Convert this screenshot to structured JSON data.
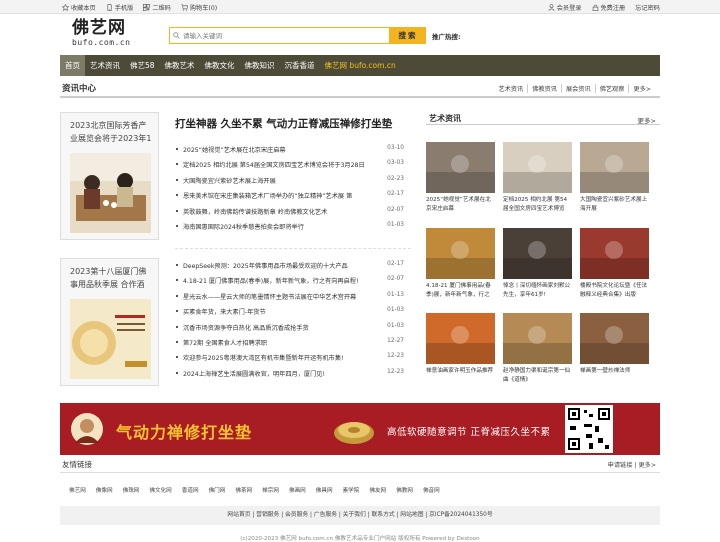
{
  "topbar": {
    "left": [
      {
        "icon": "star-icon",
        "label": "收藏本页"
      },
      {
        "icon": "phone-icon",
        "label": "手机版"
      },
      {
        "icon": "qrcode-icon",
        "label": "二维码"
      },
      {
        "icon": "cart-icon",
        "label": "购物车(0)"
      }
    ],
    "right": [
      {
        "icon": "user-icon",
        "label": "会员登录"
      },
      {
        "icon": "lock-icon",
        "label": "免费注册"
      },
      {
        "label": "忘记密码"
      }
    ]
  },
  "logo": {
    "name": "佛艺网",
    "domain": "bufo.com.cn"
  },
  "search": {
    "placeholder": "请输入关键词",
    "button": "搜索",
    "hot_label": "推广热搜:"
  },
  "nav": {
    "items": [
      "首页",
      "艺术资讯",
      "佛艺58",
      "佛教艺术",
      "佛教文化",
      "佛教知识",
      "沉香香道",
      "佛艺网 bufo.com.cn"
    ],
    "active_index": 0
  },
  "section": {
    "title": "资讯中心",
    "links": [
      "艺术资讯",
      "佛教资讯",
      "展会资讯",
      "佛艺观察",
      "更多>"
    ]
  },
  "left_cards": [
    {
      "title": "2023北京国际芳香产业展览会将于2023年1"
    },
    {
      "title": "2023第十八届厦门佛事用品秋季展 合作酒"
    }
  ],
  "headline": "打坐神器 久坐不累 气动力正脊减压禅修打坐垫",
  "news_a": [
    {
      "text": "2025“她视觉”艺术展在北京宋庄启幕",
      "date": "03-10"
    },
    {
      "text": "定档2025 相约北展 第54届全国文房四宝艺术博览会将于3月28日",
      "date": "03-03"
    },
    {
      "text": "大国陶瓷宜兴紫砂艺术展上海开展",
      "date": "02-23"
    },
    {
      "text": "恩来美术馆在宋庄集装箱艺术厂场举办的“独立精神”艺术展 第",
      "date": "02-17"
    },
    {
      "text": "英歌鼓舞，岭南佛韵传谱技路新章 岭南佛教文化艺术",
      "date": "02-07"
    },
    {
      "text": "海南国惠国际2024秋季慈善拍卖会即将举行",
      "date": "01-03"
    }
  ],
  "news_b": [
    {
      "text": "DeepSeek预测：2025年佛事用品市场最受欢迎的十大产品",
      "date": "02-17"
    },
    {
      "text": "4.18-21 厦门佛事用品(春季)展，新年新气象，行之有向再启程!",
      "date": "02-07"
    },
    {
      "text": "星光云水——星云大师的笔墨情怀主题书法展在中华艺术宫开幕",
      "date": "01-13"
    },
    {
      "text": "买素食年货，来大素门-年货节",
      "date": "01-03"
    },
    {
      "text": "沉香市场资源争夺白热化 高品质沉香成抢手货",
      "date": "01-03"
    },
    {
      "text": "第72期 全国素食人才招聘求职",
      "date": "12-27"
    },
    {
      "text": "欢迎参与2025粤港澳大湾区有机市集暨新年开运有机市集!",
      "date": "12-23"
    },
    {
      "text": "2024上海禅艺生活展圆满收官，明年四月，厦门见!",
      "date": "12-23"
    }
  ],
  "art": {
    "title": "艺术资讯",
    "more": "更多>",
    "tiles": [
      {
        "caption": "2025“她视觉”艺术展在北京宋庄启幕",
        "tone": "#8a7d70"
      },
      {
        "caption": "定档2025 相约北展 第54届全国文房四宝艺术博览",
        "tone": "#d9cfc0"
      },
      {
        "caption": "大国陶瓷宜兴紫砂艺术展上海开展",
        "tone": "#b8a894"
      },
      {
        "caption": "4.18-21 厦门佛事用品(春季)展，新年新气象，行之",
        "tone": "#c08a3a"
      },
      {
        "caption": "悼念丨深切缅怀画家刘默公先生，享年61岁!",
        "tone": "#4a4038"
      },
      {
        "caption": "楼殿书院文化论坛暨《任法融释义经典合集》出版",
        "tone": "#9a3a2e"
      },
      {
        "caption": "禅意油画家许明玉作品推荐",
        "tone": "#d06a2a"
      },
      {
        "caption": "赵净静国力渠和诞宗第一仙曲《道情》",
        "tone": "#b58a55"
      },
      {
        "caption": "禅画第一壁炒禅法师",
        "tone": "#8a6040"
      }
    ]
  },
  "banner": {
    "ad_main": "气动力禅修打坐垫",
    "ad_sub": "高低软硬随意调节 正脊减压久坐不累"
  },
  "friend_links": {
    "title": "友情链接",
    "right": "申请链接 | 更多>",
    "items": [
      "佛艺网",
      "佛像网",
      "佛珠网",
      "佛文化网",
      "香道网",
      "佛门网",
      "佛茶网",
      "禅宗网",
      "佛画网",
      "佛具网",
      "素学院",
      "佛友网",
      "佛教网",
      "佛音网"
    ]
  },
  "footer": {
    "nav": "网站首页 | 营销服务 | 会员服务 | 广告服务 | 关于我们 | 联系方式 | 网站地图 | 京ICP备2024041350号",
    "copyright": "(c)2020-2023 佛艺网 bufo.com.cn 佛教艺术品专业门户网站 版权所有 Powered by Destoon"
  },
  "colors": {
    "accent": "#f2b51f",
    "nav_bg": "#4d4a38",
    "banner_bg": "#a81c23"
  }
}
